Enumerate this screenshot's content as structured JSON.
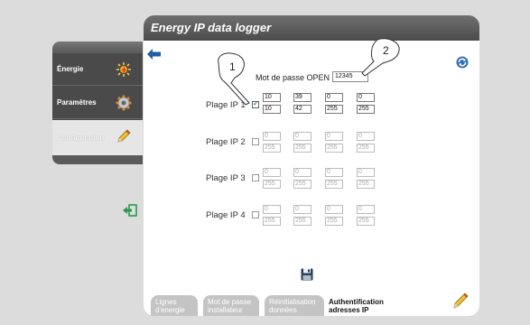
{
  "header": {
    "title": "Energy IP data logger"
  },
  "menu": {
    "items": [
      {
        "label": "Énergie",
        "icon": "energy-sun-icon"
      },
      {
        "label": "Paramètres",
        "icon": "gear-icon"
      },
      {
        "label": "Configuration",
        "icon": "pencil-icon"
      }
    ]
  },
  "password": {
    "label": "Mot de passe OPEN",
    "value": "12345"
  },
  "callouts": [
    "1",
    "2"
  ],
  "ranges": [
    {
      "label": "Plage IP 1",
      "checked": true,
      "start": [
        "10",
        "39",
        "0",
        "0"
      ],
      "end": [
        "10",
        "42",
        "255",
        "255"
      ]
    },
    {
      "label": "Plage IP 2",
      "checked": false,
      "start": [
        "0",
        "0",
        "0",
        "0"
      ],
      "end": [
        "255",
        "255",
        "255",
        "255"
      ]
    },
    {
      "label": "Plage IP 3",
      "checked": false,
      "start": [
        "0",
        "0",
        "0",
        "0"
      ],
      "end": [
        "255",
        "255",
        "255",
        "255"
      ]
    },
    {
      "label": "Plage IP 4",
      "checked": false,
      "start": [
        "0",
        "0",
        "0",
        "0"
      ],
      "end": [
        "255",
        "255",
        "255",
        "255"
      ]
    }
  ],
  "tabs": [
    {
      "line1": "Lignes",
      "line2": "d'energie"
    },
    {
      "line1": "Mot de passe",
      "line2": "installateur"
    },
    {
      "line1": "Réinitialisation",
      "line2": "données"
    },
    {
      "line1": "Authentification",
      "line2": "adresses IP"
    }
  ],
  "colors": {
    "accent_blue": "#1e5fa8",
    "menu_bg": "#4a4a4a",
    "header_bg": "#5a5a5a"
  }
}
